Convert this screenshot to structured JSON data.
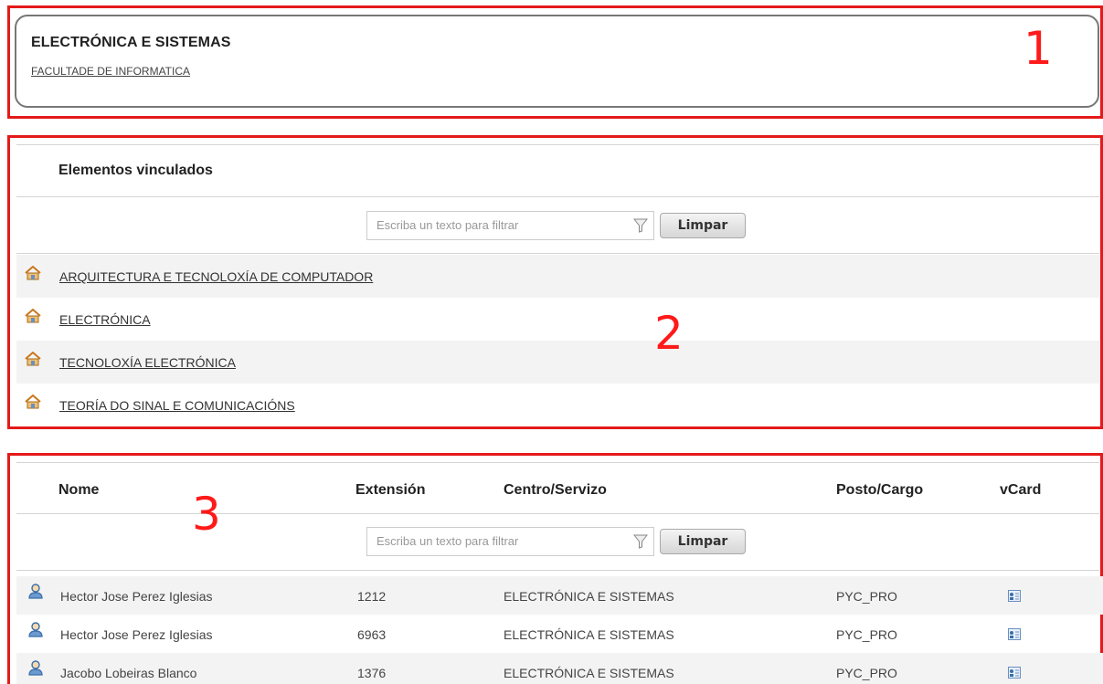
{
  "annotations": {
    "n1": "1",
    "n2": "2",
    "n3": "3"
  },
  "header": {
    "title": "ELECTRÓNICA E SISTEMAS",
    "subtitle_link": "FACULTADE DE INFORMATICA"
  },
  "linked": {
    "title": "Elementos vinculados",
    "filter_placeholder": "Escriba un texto para filtrar",
    "clear_label": "Limpar",
    "items": [
      {
        "label": "ARQUITECTURA E TECNOLOXÍA DE COMPUTADOR",
        "icon": "home-icon"
      },
      {
        "label": "ELECTRÓNICA",
        "icon": "home-icon"
      },
      {
        "label": "TECNOLOXÍA ELECTRÓNICA",
        "icon": "home-icon"
      },
      {
        "label": "TEORÍA DO SINAL E COMUNICACIÓNS",
        "icon": "home-icon"
      }
    ]
  },
  "people": {
    "columns": {
      "name": "Nome",
      "extension": "Extensión",
      "center": "Centro/Servizo",
      "post": "Posto/Cargo",
      "vcard": "vCard"
    },
    "filter_placeholder": "Escriba un texto para filtrar",
    "clear_label": "Limpar",
    "rows": [
      {
        "name": "Hector Jose Perez Iglesias",
        "extension": "1212",
        "center": "ELECTRÓNICA E SISTEMAS",
        "post": "PYC_PRO"
      },
      {
        "name": "Hector Jose Perez Iglesias",
        "extension": "6963",
        "center": "ELECTRÓNICA E SISTEMAS",
        "post": "PYC_PRO"
      },
      {
        "name": "Jacobo Lobeiras Blanco",
        "extension": "1376",
        "center": "ELECTRÓNICA E SISTEMAS",
        "post": "PYC_PRO"
      }
    ]
  },
  "colors": {
    "annotation_red": "#e41a1a",
    "row_alt": "#f3f3f3"
  }
}
